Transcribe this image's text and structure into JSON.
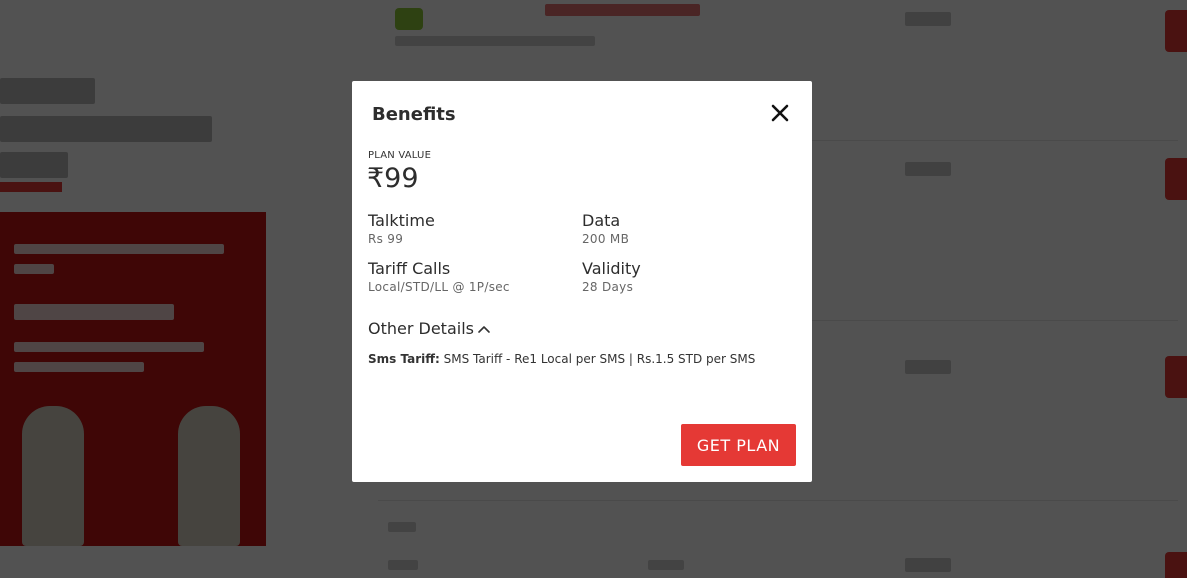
{
  "modal": {
    "title": "Benefits",
    "plan_value_label": "PLAN VALUE",
    "plan_value": "₹99",
    "benefits": [
      {
        "title": "Talktime",
        "value": "Rs 99"
      },
      {
        "title": "Data",
        "value": "200 MB"
      },
      {
        "title": "Tariff Calls",
        "value": "Local/STD/LL @ 1P/sec"
      },
      {
        "title": "Validity",
        "value": "28 Days"
      }
    ],
    "other_details_label": "Other Details",
    "sms_tariff_key": "Sms Tariff:",
    "sms_tariff_value": "SMS Tariff - Re1 Local per SMS | Rs.1.5 STD per SMS",
    "get_plan_label": "GET PLAN"
  },
  "icons": {
    "close": "close-icon",
    "chevron": "chevron-up-icon"
  },
  "colors": {
    "accent": "#e53935",
    "overlay": "rgba(0,0,0,0.68)"
  }
}
